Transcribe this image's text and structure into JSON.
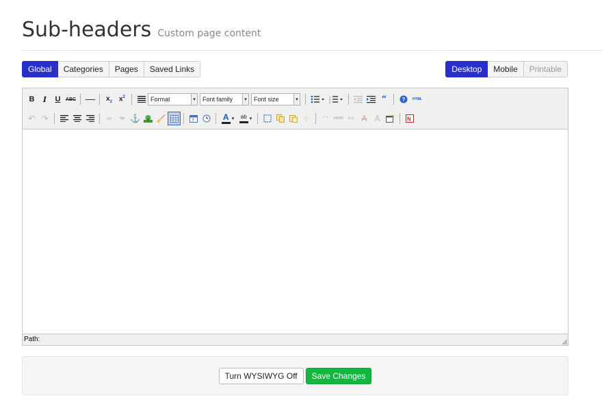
{
  "page": {
    "title": "Sub-headers",
    "subtitle": "Custom page content"
  },
  "scope_tabs": [
    {
      "label": "Global",
      "active": true
    },
    {
      "label": "Categories",
      "active": false
    },
    {
      "label": "Pages",
      "active": false
    },
    {
      "label": "Saved Links",
      "active": false
    }
  ],
  "device_tabs": [
    {
      "label": "Desktop",
      "active": true
    },
    {
      "label": "Mobile",
      "active": false
    },
    {
      "label": "Printable",
      "disabled": true
    }
  ],
  "toolbar": {
    "format_label": "Format",
    "font_family_label": "Font family",
    "font_size_label": "Font size",
    "bold": "B",
    "italic": "I",
    "underline": "U",
    "strike": "ABC",
    "sub": "x",
    "sup": "x",
    "text_color": "A",
    "bg_color": "ab",
    "html_label": "HTML"
  },
  "statusbar": {
    "path_label": "Path:"
  },
  "actions": {
    "wysiwyg_label": "Turn WYSIWYG Off",
    "save_label": "Save Changes"
  },
  "colors": {
    "accent": "#2a2fc7",
    "success": "#13b63f"
  }
}
